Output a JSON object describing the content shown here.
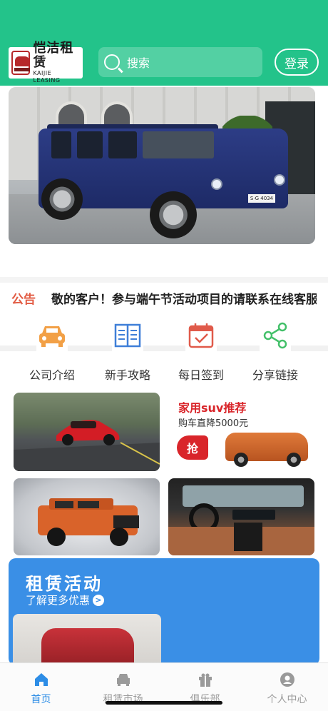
{
  "header": {
    "logo_cn": "恺洁租赁",
    "logo_en": "KAIJIE LEASING",
    "search_placeholder": "搜索",
    "login_label": "登录",
    "bg_color": "#23c38a"
  },
  "banner": {
    "plate_text": "S·G 4034"
  },
  "notice": {
    "tag": "公告",
    "text": "敬的客户！参与端午节活动项目的请联系在线客服"
  },
  "quick_nav": [
    {
      "label": "公司介绍",
      "icon": "car-front-icon",
      "color": "#f2a046"
    },
    {
      "label": "新手攻略",
      "icon": "book-icon",
      "color": "#3f7fd8"
    },
    {
      "label": "每日签到",
      "icon": "calendar-check-icon",
      "color": "#e05a4a"
    },
    {
      "label": "分享链接",
      "icon": "share-icon",
      "color": "#44c06a"
    }
  ],
  "promo": {
    "suv_title": "家用suv推荐",
    "suv_sub": "购车直降5000元",
    "grab_label": "抢"
  },
  "activity": {
    "title": "租赁活动",
    "subtitle": "了解更多优惠"
  },
  "tabbar": {
    "tabs": [
      {
        "label": "首页",
        "icon": "home-icon",
        "active": true
      },
      {
        "label": "租赁市场",
        "icon": "car-icon",
        "active": false
      },
      {
        "label": "俱乐部",
        "icon": "gift-icon",
        "active": false
      },
      {
        "label": "个人中心",
        "icon": "user-icon",
        "active": false
      }
    ],
    "active_color": "#2d8de6"
  }
}
